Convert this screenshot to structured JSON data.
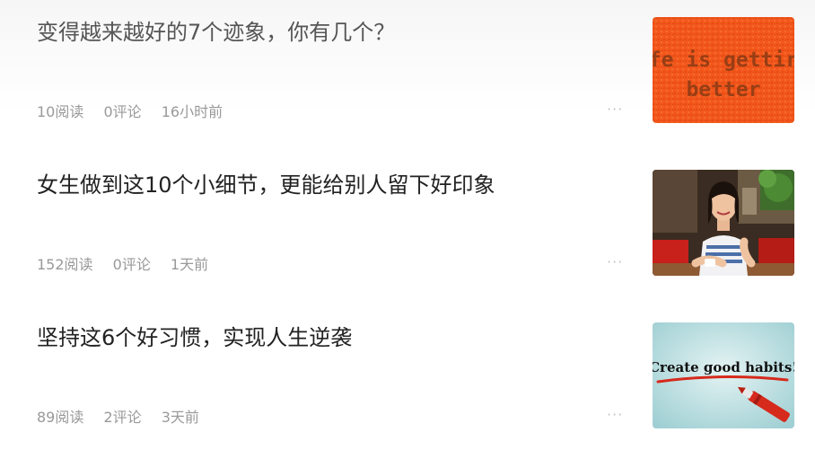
{
  "articles": [
    {
      "title": "变得越来越好的7个迹象，你有几个？",
      "reads": "10阅读",
      "comments": "0评论",
      "time": "16小时前",
      "more": "···",
      "thumb_text_line1": "fe is gettir",
      "thumb_text_line2": "better"
    },
    {
      "title": "女生做到这10个小细节，更能给别人留下好印象",
      "reads": "152阅读",
      "comments": "0评论",
      "time": "1天前",
      "more": "···"
    },
    {
      "title": "坚持这6个好习惯，实现人生逆袭",
      "reads": "89阅读",
      "comments": "2评论",
      "time": "3天前",
      "more": "···",
      "thumb_text": "Create good habits!"
    }
  ],
  "colors": {
    "title": "#222222",
    "meta": "#999999",
    "orange_thumb": "#f2571c",
    "teal_thumb": "#bfe0e2",
    "marker_red": "#d62a1c"
  }
}
